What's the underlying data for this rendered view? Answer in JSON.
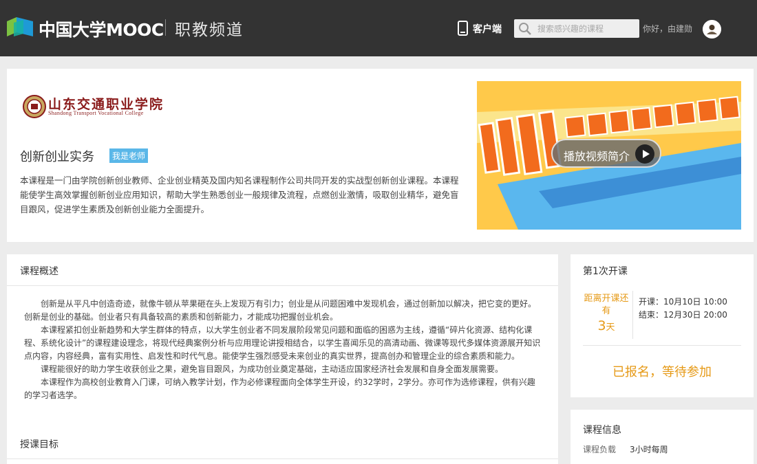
{
  "header": {
    "logo_text": "中国大学MOOC",
    "channel": "职教频道",
    "client_link": "客户端",
    "search_placeholder": "搜索感兴趣的课程",
    "greeting": "你好，由建勋"
  },
  "course": {
    "school_name": "山东交通职业学院",
    "school_name_en": "Shandong Transport Vocational College",
    "title": "创新创业实务",
    "teacher_badge": "我是老师",
    "description": "本课程是一门由学院创新创业教师、企业创业精英及国内知名课程制作公司共同开发的实战型创新创业课程。本课程能使学生高效掌握创新创业应用知识，帮助大学生熟悉创业一般规律及流程，点燃创业激情，吸取创业精华，避免盲目跟风，促进学生素质及创新创业能力全面提升。",
    "play_intro": "播放视频简介"
  },
  "overview": {
    "heading": "课程概述",
    "paragraphs": [
      "创新是从平凡中创造奇迹，就像牛顿从苹果砸在头上发现万有引力；创业是从问题困难中发现机会，通过创新加以解决，把它变的更好。创新是创业的基础。创业者只有具备较高的素质和创新能力，才能成功把握创业机会。",
      "本课程紧扣创业新趋势和大学生群体的特点，以大学生创业者不同发展阶段常见问题和面临的困惑为主线，遵循“碎片化资源、结构化课程、系统化设计”的课程建设理念，将现代经典案例分析与应用理论讲授相结合，以学生喜闻乐见的高清动画、微课等现代多媒体资源展开知识点内容，内容经典，富有实用性、启发性和时代气息。能使学生强烈感受未来创业的真实世界，提高创办和管理企业的综合素质和能力。",
      "课程能很好的助力学生收获创业之果，避免盲目跟风，为成功创业奠定基础，主动适应国家经济社会发展和自身全面发展需要。",
      "本课程作为高校创业教育入门课，可纳入教学计划，作为必修课程面向全体学生开设，约32学时，2学分。亦可作为选修课程，供有兴趣的学习者选学。"
    ],
    "goal_heading": "授课目标"
  },
  "session": {
    "heading": "第1次开课",
    "countdown_label": "距离开课还有",
    "countdown_days": "3",
    "countdown_unit": "天",
    "start": "开课：10月10日 10:00",
    "end": "结束：12月30日 20:00",
    "status": "已报名，等待参加"
  },
  "info": {
    "heading": "课程信息",
    "load_label": "课程负载",
    "load_value": "3小时每周"
  },
  "colors": {
    "topbar": "#333333",
    "accent_orange": "#e69a17",
    "badge_blue": "#5ab7e8",
    "school_red": "#8a1b1b"
  }
}
